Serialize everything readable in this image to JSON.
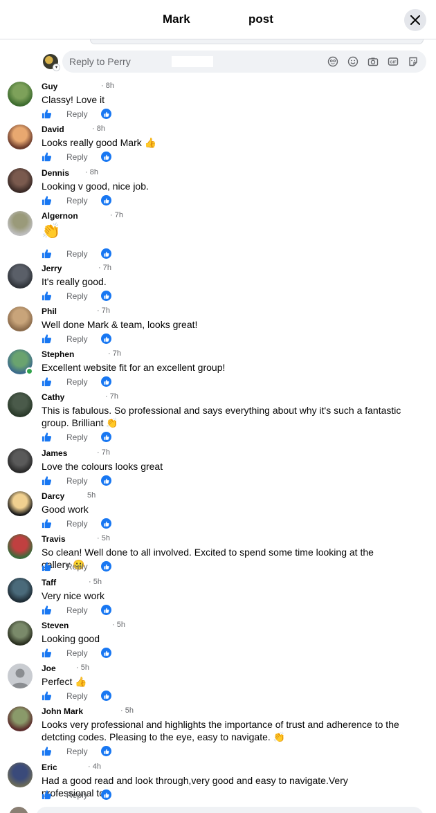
{
  "header": {
    "title_part1": "Mark",
    "title_part2": "post"
  },
  "reply_box": {
    "placeholder": "Reply to Perry"
  },
  "comments": [
    {
      "name": "Guy",
      "time": "· 8h",
      "text": "Classy! Love it",
      "reply": "Reply"
    },
    {
      "name": "David",
      "time": "· 8h",
      "text": "Looks really good Mark 👍",
      "reply": "Reply"
    },
    {
      "name": "Dennis",
      "time": "· 8h",
      "text": "Looking v good, nice job.",
      "reply": "Reply"
    },
    {
      "name": "Algernon",
      "time": "· 7h",
      "text": "👏",
      "reply": "Reply"
    },
    {
      "name": "Jerry",
      "time": "· 7h",
      "text": "It's really good.",
      "reply": "Reply"
    },
    {
      "name": "Phil",
      "time": "· 7h",
      "text": "Well done Mark & team, looks great!",
      "reply": "Reply"
    },
    {
      "name": "Stephen",
      "time": "· 7h",
      "text": "Excellent website fit for an excellent group!",
      "reply": "Reply"
    },
    {
      "name": "Cathy",
      "time": "· 7h",
      "text": "This is fabulous. So professional and says everything about why it's such a fantastic group. Brilliant 👏",
      "reply": "Reply"
    },
    {
      "name": "James",
      "time": "· 7h",
      "text": "Love the colours looks great",
      "reply": "Reply"
    },
    {
      "name": "Darcy",
      "time": "5h",
      "text": "Good work",
      "reply": "Reply"
    },
    {
      "name": "Travis",
      "time": "· 5h",
      "text": "So clean! Well done to all involved. Excited to spend some time looking at the gallery 🙂",
      "reply": "Reply"
    },
    {
      "name": "Taff",
      "time": "· 5h",
      "text": "Very nice work",
      "reply": "Reply"
    },
    {
      "name": "Steven",
      "time": "· 5h",
      "text": "Looking good",
      "reply": "Reply"
    },
    {
      "name": "Joe",
      "time": "· 5h",
      "text": "Perfect 👍",
      "reply": "Reply"
    },
    {
      "name": "John Mark",
      "time": "· 5h",
      "text": "Looks very professional and highlights the importance of trust and adherence to the detcting codes. Pleasing to the eye, easy to navigate. 👏",
      "reply": "Reply"
    },
    {
      "name": "Eric",
      "time": "· 4h",
      "text": "Had a good read and look through,very good and easy to navigate.Very professional to.",
      "reply": "Reply"
    }
  ],
  "icons": [
    "close-icon",
    "avatar-icon",
    "emoji-icon",
    "smile-icon",
    "camera-icon",
    "gif-icon",
    "sticker-icon",
    "like-icon",
    "like-reaction-icon"
  ],
  "colors": {
    "accent": "#1877f2",
    "muted": "#65676b",
    "input_bg": "#f0f2f5",
    "online": "#31a24c"
  }
}
